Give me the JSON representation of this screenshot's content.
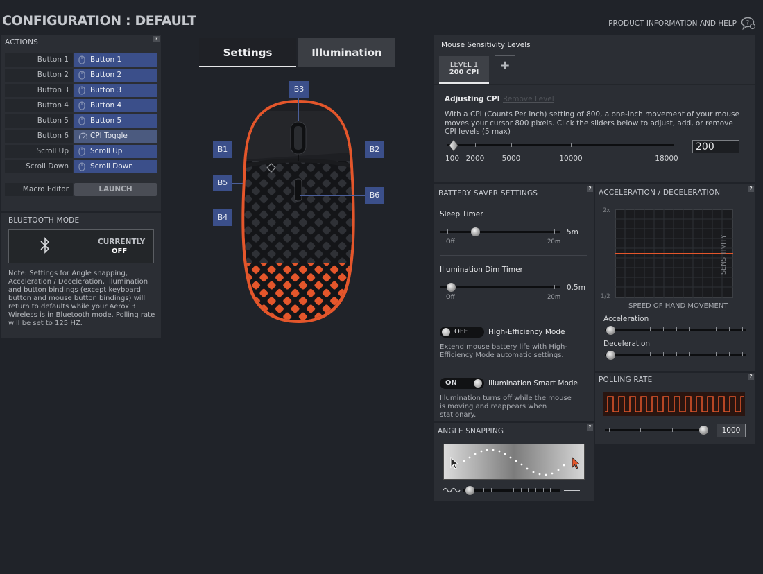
{
  "header": {
    "title": "CONFIGURATION : DEFAULT",
    "help_link": "PRODUCT INFORMATION AND HELP"
  },
  "actions": {
    "title": "ACTIONS",
    "rows": [
      {
        "label": "Button 1",
        "binding": "Button 1",
        "icon": "mouse-icon"
      },
      {
        "label": "Button 2",
        "binding": "Button 2",
        "icon": "mouse-icon"
      },
      {
        "label": "Button 3",
        "binding": "Button 3",
        "icon": "mouse-icon"
      },
      {
        "label": "Button 4",
        "binding": "Button 4",
        "icon": "mouse-icon"
      },
      {
        "label": "Button 5",
        "binding": "Button 5",
        "icon": "mouse-icon"
      },
      {
        "label": "Button 6",
        "binding": "CPI Toggle",
        "icon": "gauge-icon"
      },
      {
        "label": "Scroll Up",
        "binding": "Scroll Up",
        "icon": "mouse-icon"
      },
      {
        "label": "Scroll Down",
        "binding": "Scroll Down",
        "icon": "mouse-icon"
      }
    ],
    "macro_label": "Macro Editor",
    "macro_button": "LAUNCH"
  },
  "bluetooth": {
    "title": "BLUETOOTH MODE",
    "status_label": "CURRENTLY",
    "status_value": "OFF",
    "note": "Note: Settings for Angle snapping, Acceleration / Deceleration, Illumination and button bindings (except keyboard button and mouse button bindings) will return to defaults while your Aerox 3 Wireless is in Bluetooth mode. Polling rate will be set to 125 HZ."
  },
  "tabs": {
    "settings": "Settings",
    "illumination": "Illumination",
    "active": "settings"
  },
  "mouse": {
    "callouts": {
      "b1": "B1",
      "b2": "B2",
      "b3": "B3",
      "b4": "B4",
      "b5": "B5",
      "b6": "B6"
    }
  },
  "sensitivity": {
    "title": "Mouse Sensitivity Levels",
    "level_name": "LEVEL 1",
    "level_cpi": "200 CPI",
    "add_label": "+",
    "adjusting_title": "Adjusting CPI",
    "remove_level": "Remove Level",
    "description": "With a CPI (Counts Per Inch) setting of 800, a one-inch movement of your mouse moves your cursor 800 pixels. Click the sliders below to adjust, add, or remove CPI levels (5 max)",
    "ticks": [
      "100",
      "2000",
      "5000",
      "10000",
      "18000"
    ],
    "tick_values": [
      100,
      2000,
      5000,
      10000,
      18000
    ],
    "min": 100,
    "max": 18000,
    "value": 200,
    "input_value": "200"
  },
  "battery": {
    "title": "BATTERY SAVER SETTINGS",
    "sleep_title": "Sleep Timer",
    "sleep_value": "5m",
    "sleep_fraction": 0.25,
    "sleep_min": "Off",
    "sleep_max": "20m",
    "dim_title": "Illumination Dim Timer",
    "dim_value": "0.5m",
    "dim_fraction": 0.025,
    "dim_min": "Off",
    "dim_max": "20m",
    "hem_state": "OFF",
    "hem_title": "High-Efficiency Mode",
    "hem_desc": "Extend mouse battery life with High-Efficiency Mode automatic settings.",
    "smart_state": "ON",
    "smart_title": "Illumination Smart Mode",
    "smart_desc": "Illumination turns off while the mouse is moving and reappears when stationary."
  },
  "accel": {
    "title": "ACCELERATION / DECELERATION",
    "y_top": "2x",
    "y_bottom": "1/2",
    "y_label": "SENSITIVITY",
    "x_label": "SPEED OF HAND MOVEMENT",
    "accel_label": "Acceleration",
    "decel_label": "Deceleration",
    "accel_fraction": 0,
    "decel_fraction": 0
  },
  "polling": {
    "title": "POLLING RATE",
    "value": "1000",
    "fraction": 1
  },
  "angle": {
    "title": "ANGLE SNAPPING",
    "fraction": 0
  },
  "colors": {
    "accent_blue": "#3b4f8a",
    "accent_orange": "#e4562b",
    "panel": "#2b2e34",
    "background": "#202329"
  }
}
